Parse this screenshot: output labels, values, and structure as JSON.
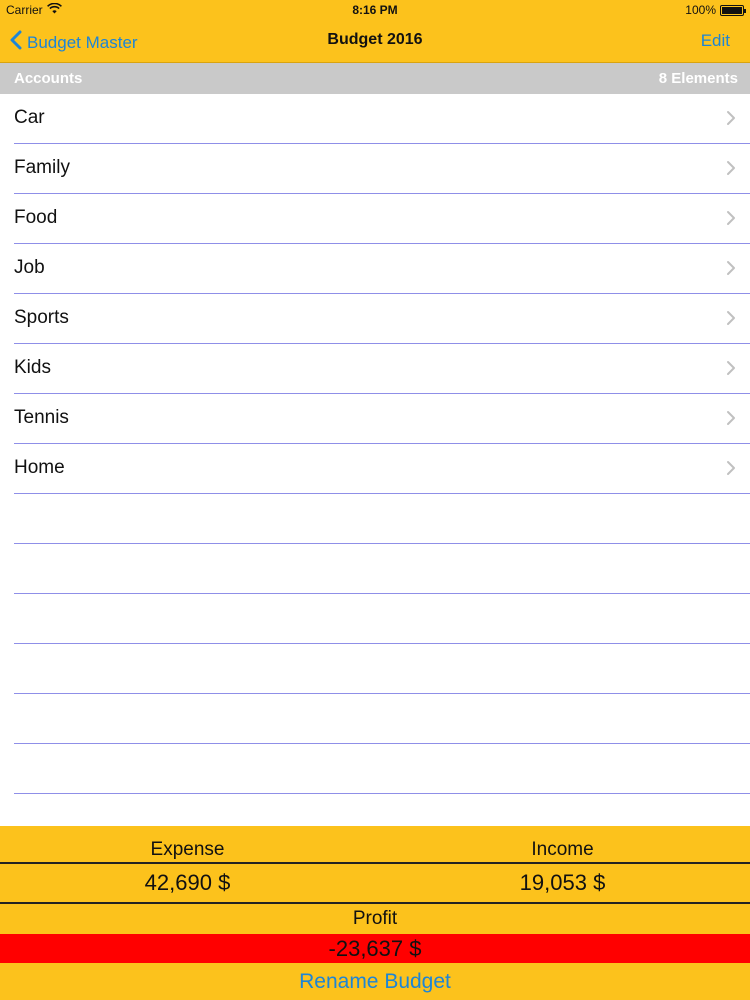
{
  "status_bar": {
    "carrier": "Carrier",
    "time": "8:16 PM",
    "battery": "100%"
  },
  "nav": {
    "back_label": "Budget Master",
    "title": "Budget 2016",
    "edit_label": "Edit"
  },
  "section": {
    "title": "Accounts",
    "count": "8 Elements"
  },
  "accounts": [
    {
      "label": "Car"
    },
    {
      "label": "Family"
    },
    {
      "label": "Food"
    },
    {
      "label": "Job"
    },
    {
      "label": "Sports"
    },
    {
      "label": "Kids"
    },
    {
      "label": "Tennis"
    },
    {
      "label": "Home"
    }
  ],
  "summary": {
    "expense_label": "Expense",
    "income_label": "Income",
    "expense_value": "42,690 $",
    "income_value": "19,053 $",
    "profit_label": "Profit",
    "profit_value": "-23,637 $",
    "rename_label": "Rename Budget"
  },
  "colors": {
    "bar_yellow": "#fcc21c",
    "link_blue": "#1d85d6",
    "section_gray": "#c9c9c9",
    "separator": "#8f8fe8",
    "profit_negative": "#ff0000"
  },
  "icons": {
    "wifi": "wifi-icon",
    "back": "chevron-left-icon",
    "row": "chevron-right-icon",
    "battery": "battery-icon"
  }
}
